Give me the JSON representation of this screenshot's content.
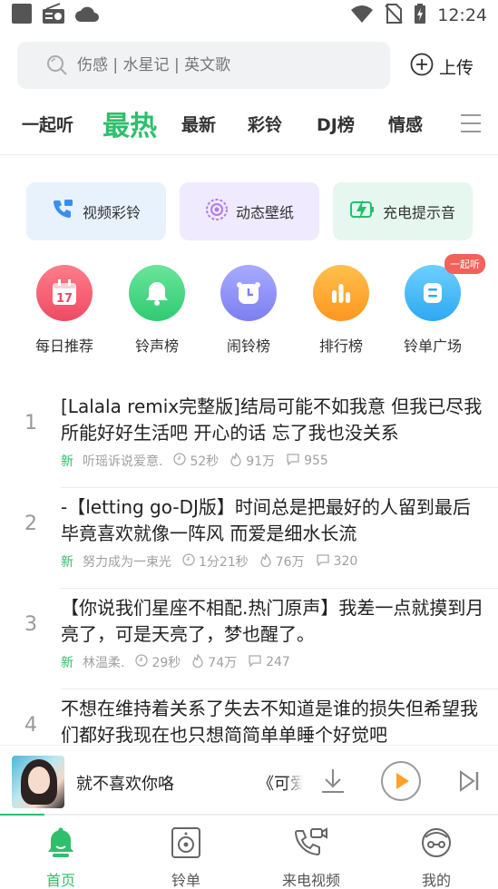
{
  "status_bar": {
    "time": "12:24"
  },
  "search": {
    "placeholder": "伤感 | 水星记 | 英文歌"
  },
  "upload": {
    "label": "上传"
  },
  "tabs": [
    {
      "label": "一起听"
    },
    {
      "label": "最热",
      "active": true
    },
    {
      "label": "最新"
    },
    {
      "label": "彩铃"
    },
    {
      "label": "DJ榜"
    },
    {
      "label": "情感"
    }
  ],
  "features": [
    {
      "label": "视频彩铃",
      "icon": "video-phone-icon"
    },
    {
      "label": "动态壁纸",
      "icon": "live-wallpaper-icon"
    },
    {
      "label": "充电提示音",
      "icon": "charging-icon"
    }
  ],
  "categories": [
    {
      "label": "每日推荐",
      "icon": "calendar-icon",
      "icon_text": "17",
      "color": "#f25a6a"
    },
    {
      "label": "铃声榜",
      "icon": "bell-icon",
      "color": "#3dd47e"
    },
    {
      "label": "闹铃榜",
      "icon": "alarm-clock-icon",
      "color": "#8b8ef5"
    },
    {
      "label": "排行榜",
      "icon": "bar-chart-icon",
      "color": "#ffa12a"
    },
    {
      "label": "铃单广场",
      "icon": "playlist-icon",
      "color": "#42b7f5",
      "badge": "一起听"
    }
  ],
  "songs": [
    {
      "rank": "1",
      "title": "[Lalala remix完整版]结局可能不如我意 但我已尽我所能好好生活吧 开心的话 忘了我也没关系",
      "tag": "新",
      "author": "听瑶诉说爱意.",
      "duration": "52秒",
      "likes": "91万",
      "comments": "955"
    },
    {
      "rank": "2",
      "title": "-【letting go-DJ版】时间总是把最好的人留到最后 毕竟喜欢就像一阵风 而爱是细水长流",
      "tag": "新",
      "author": "努力成为一束光",
      "duration": "1分21秒",
      "likes": "76万",
      "comments": "320"
    },
    {
      "rank": "3",
      "title": "【你说我们星座不相配.热门原声】我差一点就摸到月亮了，可是天亮了，梦也醒了。",
      "tag": "新",
      "author": "林温柔.",
      "duration": "29秒",
      "likes": "74万",
      "comments": "247"
    },
    {
      "rank": "4",
      "title": "不想在维持着关系了失去不知道是谁的损失但希望我们都好我现在也只想简简单单睡个好觉吧",
      "tag": "",
      "author": "",
      "duration": "",
      "likes": "",
      "comments": ""
    }
  ],
  "player": {
    "now_playing": "就不喜欢你咯",
    "next_title": "《可爱",
    "progress": 0.09
  },
  "bottom_nav": [
    {
      "label": "首页",
      "icon": "home-bell-icon",
      "active": true
    },
    {
      "label": "铃单",
      "icon": "speaker-icon"
    },
    {
      "label": "来电视频",
      "icon": "phone-video-icon"
    },
    {
      "label": "我的",
      "icon": "profile-icon"
    }
  ],
  "colors": {
    "accent": "#2dbf6a",
    "badge": "#f0625a"
  }
}
